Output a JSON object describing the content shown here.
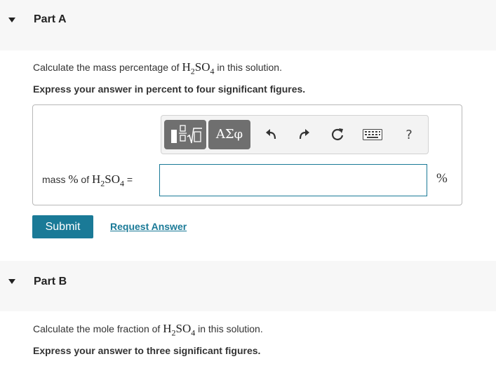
{
  "partA": {
    "title": "Part A",
    "question_prefix": "Calculate the mass percentage of ",
    "question_suffix": " in this solution.",
    "formula": {
      "base1": "H",
      "sub1": "2",
      "base2": "SO",
      "sub2": "4"
    },
    "instruction": "Express your answer in percent to four significant figures.",
    "toolbar": {
      "greek_label": "ΑΣφ",
      "help_label": "?",
      "icons": [
        "templates-icon",
        "undo-icon",
        "redo-icon",
        "reset-icon",
        "keyboard-icon",
        "help-icon"
      ]
    },
    "answer": {
      "label_prefix": "mass ",
      "label_percent": "%",
      "label_mid": " of ",
      "label_equals": " =",
      "value": "",
      "unit": "%"
    },
    "submit_label": "Submit",
    "request_answer_label": "Request Answer"
  },
  "partB": {
    "title": "Part B",
    "question_prefix": "Calculate the mole fraction of ",
    "question_suffix": " in this solution.",
    "instruction": "Express your answer to three significant figures."
  },
  "colors": {
    "accent": "#1a7a97",
    "header_bg": "#f7f7f7",
    "toolbar_button": "#6f6f6f"
  }
}
